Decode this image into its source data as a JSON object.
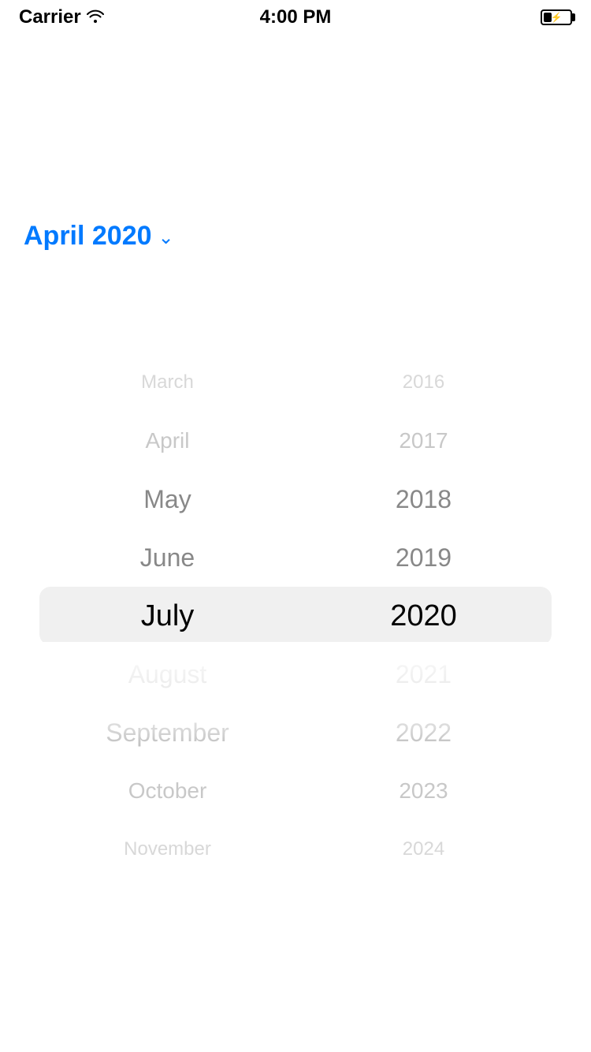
{
  "statusBar": {
    "carrier": "Carrier",
    "time": "4:00 PM"
  },
  "header": {
    "monthTitle": "April 2020",
    "chevron": "chevron-down"
  },
  "picker": {
    "months": {
      "aboveFar": "March",
      "above2": "April",
      "above1": "May",
      "above0": "June",
      "selected": "July",
      "below1": "August",
      "below2": "September",
      "below3": "October",
      "belowFar": "November"
    },
    "years": {
      "aboveFar": "2016",
      "above2": "2017",
      "above1": "2018",
      "above0": "2019",
      "selected": "2020",
      "below1": "2021",
      "below2": "2022",
      "below3": "2023",
      "belowFar": "2024"
    }
  }
}
